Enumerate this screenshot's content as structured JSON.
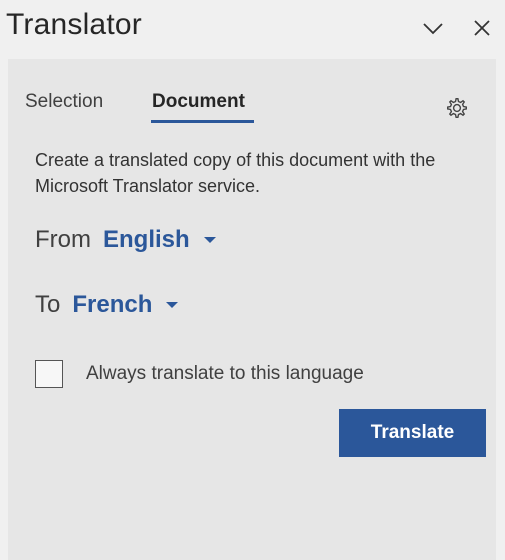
{
  "header": {
    "title": "Translator",
    "collapse_icon": "chevron-down-icon",
    "close_icon": "close-icon"
  },
  "tabs": [
    {
      "label": "Selection",
      "active": false
    },
    {
      "label": "Document",
      "active": true
    }
  ],
  "settings_icon": "gear-icon",
  "description": "Create a translated copy of this document with the Microsoft Translator service.",
  "from": {
    "label": "From",
    "value": "English"
  },
  "to": {
    "label": "To",
    "value": "French"
  },
  "always_translate": {
    "label": "Always translate to this language",
    "checked": false
  },
  "translate_button": {
    "label": "Translate"
  },
  "colors": {
    "accent": "#2b579a",
    "pane_background": "#e6e6e6",
    "title_background": "#f0f0f0"
  }
}
